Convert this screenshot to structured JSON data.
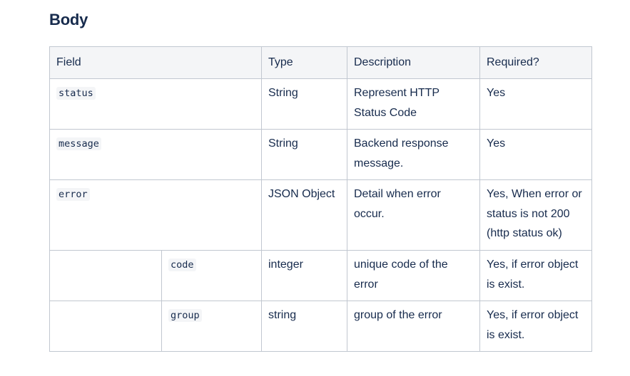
{
  "section": {
    "heading": "Body"
  },
  "table": {
    "headers": {
      "field": "Field",
      "type": "Type",
      "description": "Description",
      "required": "Required?"
    },
    "rows": [
      {
        "field": "status",
        "type": "String",
        "description": "Represent HTTP Status Code",
        "required": "Yes"
      },
      {
        "field": "message",
        "type": "String",
        "description": "Backend response message.",
        "required": "Yes"
      },
      {
        "field": "error",
        "type": "JSON Object",
        "description": "Detail when error occur.",
        "required": "Yes, When error or status is not 200 (http status ok)"
      },
      {
        "parent": "",
        "field": "code",
        "type": "integer",
        "description": "unique code of the error",
        "required": "Yes, if error object is exist."
      },
      {
        "parent": "",
        "field": "group",
        "type": "string",
        "description": "group of the error",
        "required": "Yes, if error object is exist."
      }
    ]
  }
}
